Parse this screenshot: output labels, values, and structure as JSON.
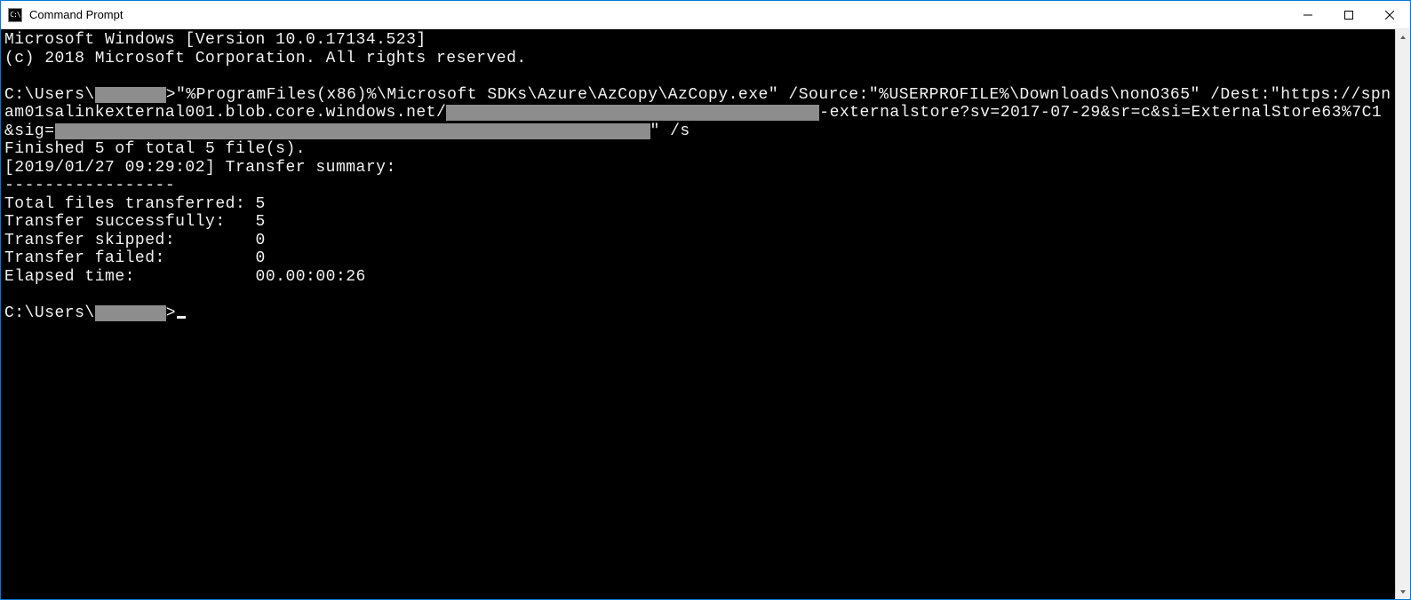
{
  "window": {
    "title": "Command Prompt"
  },
  "terminal": {
    "line1": "Microsoft Windows [Version 10.0.17134.523]",
    "line2": "(c) 2018 Microsoft Corporation. All rights reserved.",
    "prompt_prefix": "C:\\Users\\",
    "cmd_a": ">\"%ProgramFiles(x86)%\\Microsoft SDKs\\Azure\\AzCopy\\AzCopy.exe\" /Source:\"%USERPROFILE%\\Downloads\\nonO365\" /Dest:\"https://spnam01salinkexternal001.blob.core.windows.net/",
    "cmd_b": "-externalstore?sv=2017-07-29&sr=c&si=ExternalStore63%7C1&sig=",
    "cmd_c": "\" /s",
    "finished": "Finished 5 of total 5 file(s).",
    "summary_ts": "[2019/01/27 09:29:02] Transfer summary:",
    "divider": "-----------------",
    "total_transferred": "Total files transferred: 5",
    "transfer_success": "Transfer successfully:   5",
    "transfer_skipped": "Transfer skipped:        0",
    "transfer_failed": "Transfer failed:         0",
    "elapsed": "Elapsed time:            00.00:00:26",
    "prompt2_prefix": "C:\\Users\\",
    "prompt2_suffix": ">"
  }
}
